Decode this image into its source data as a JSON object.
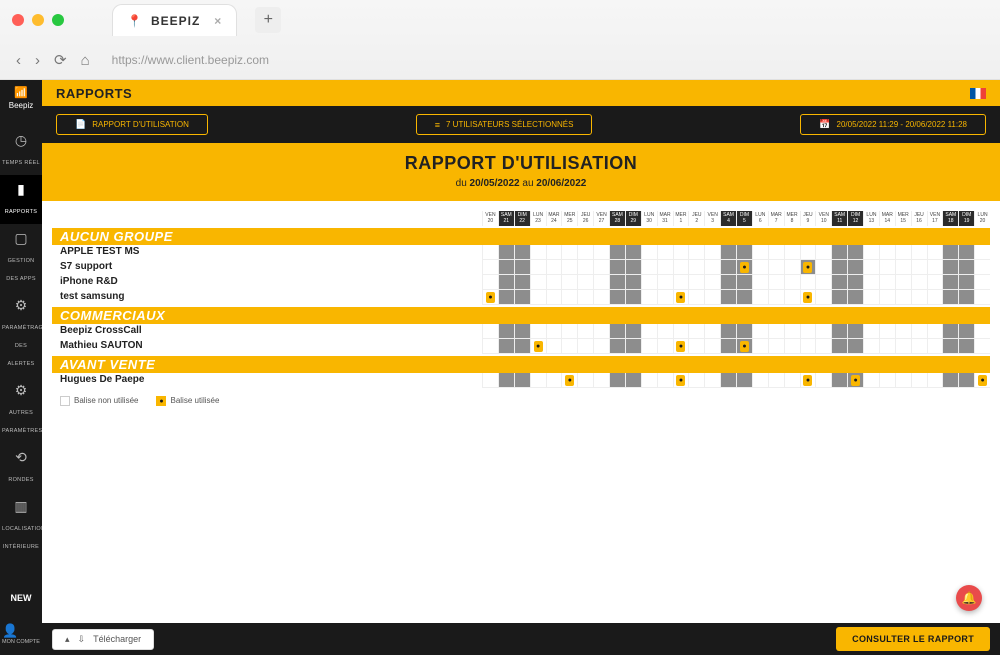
{
  "browser": {
    "tab_title": "BEEPIZ",
    "url": "https://www.client.beepiz.com"
  },
  "sidebar": {
    "brand": "Beepiz",
    "items": [
      {
        "icon": "◷",
        "label": "TEMPS RÉEL"
      },
      {
        "icon": "▮",
        "label": "RAPPORTS"
      },
      {
        "icon": "▢",
        "label": "GESTION DES APPS"
      },
      {
        "icon": "⚙",
        "label": "PARAMÉTRAGE DES ALERTES"
      },
      {
        "icon": "⚙",
        "label": "AUTRES PARAMÈTRES"
      },
      {
        "icon": "⟲",
        "label": "RONDES"
      },
      {
        "icon": "▥",
        "label": "LOCALISATION INTÉRIEURE"
      }
    ],
    "new_label": "NEW",
    "account_label": "MON COMPTE"
  },
  "header": {
    "title": "RAPPORTS"
  },
  "actions": {
    "report_type": "RAPPORT D'UTILISATION",
    "users_selected": "7 UTILISATEURS SÉLECTIONNÉS",
    "daterange": "20/05/2022 11:29 - 20/06/2022 11:28"
  },
  "subheader": {
    "title": "RAPPORT D'UTILISATION",
    "prefix": "du",
    "from": "20/05/2022",
    "middle": "au",
    "to": "20/06/2022"
  },
  "days": [
    {
      "dow": "VEN",
      "num": "20",
      "we": false
    },
    {
      "dow": "SAM",
      "num": "21",
      "we": true
    },
    {
      "dow": "DIM",
      "num": "22",
      "we": true
    },
    {
      "dow": "LUN",
      "num": "23",
      "we": false
    },
    {
      "dow": "MAR",
      "num": "24",
      "we": false
    },
    {
      "dow": "MER",
      "num": "25",
      "we": false
    },
    {
      "dow": "JEU",
      "num": "26",
      "we": false
    },
    {
      "dow": "VEN",
      "num": "27",
      "we": false
    },
    {
      "dow": "SAM",
      "num": "28",
      "we": true
    },
    {
      "dow": "DIM",
      "num": "29",
      "we": true
    },
    {
      "dow": "LUN",
      "num": "30",
      "we": false
    },
    {
      "dow": "MAR",
      "num": "31",
      "we": false
    },
    {
      "dow": "MER",
      "num": "1",
      "we": false
    },
    {
      "dow": "JEU",
      "num": "2",
      "we": false
    },
    {
      "dow": "VEN",
      "num": "3",
      "we": false
    },
    {
      "dow": "SAM",
      "num": "4",
      "we": true
    },
    {
      "dow": "DIM",
      "num": "5",
      "we": true
    },
    {
      "dow": "LUN",
      "num": "6",
      "we": false
    },
    {
      "dow": "MAR",
      "num": "7",
      "we": false
    },
    {
      "dow": "MER",
      "num": "8",
      "we": false
    },
    {
      "dow": "JEU",
      "num": "9",
      "we": false
    },
    {
      "dow": "VEN",
      "num": "10",
      "we": false
    },
    {
      "dow": "SAM",
      "num": "11",
      "we": true
    },
    {
      "dow": "DIM",
      "num": "12",
      "we": true
    },
    {
      "dow": "LUN",
      "num": "13",
      "we": false
    },
    {
      "dow": "MAR",
      "num": "14",
      "we": false
    },
    {
      "dow": "MER",
      "num": "15",
      "we": false
    },
    {
      "dow": "JEU",
      "num": "16",
      "we": false
    },
    {
      "dow": "VEN",
      "num": "17",
      "we": false
    },
    {
      "dow": "SAM",
      "num": "18",
      "we": true
    },
    {
      "dow": "DIM",
      "num": "19",
      "we": true
    },
    {
      "dow": "LUN",
      "num": "20",
      "we": false
    }
  ],
  "groups": [
    {
      "name": "AUCUN GROUPE",
      "rows": [
        {
          "name": "APPLE TEST MS",
          "cells": [
            0,
            2,
            2,
            0,
            0,
            0,
            0,
            0,
            2,
            2,
            0,
            0,
            0,
            0,
            0,
            2,
            2,
            0,
            0,
            0,
            0,
            0,
            2,
            2,
            0,
            0,
            0,
            0,
            0,
            2,
            2,
            0
          ]
        },
        {
          "name": "S7 support",
          "cells": [
            0,
            2,
            2,
            0,
            0,
            0,
            0,
            0,
            2,
            2,
            0,
            0,
            0,
            0,
            0,
            2,
            3,
            0,
            0,
            0,
            3,
            0,
            2,
            2,
            0,
            0,
            0,
            0,
            0,
            2,
            2,
            0
          ]
        },
        {
          "name": "iPhone R&D",
          "cells": [
            0,
            2,
            2,
            0,
            0,
            0,
            0,
            0,
            2,
            2,
            0,
            0,
            0,
            0,
            0,
            2,
            2,
            0,
            0,
            0,
            0,
            0,
            2,
            2,
            0,
            0,
            0,
            0,
            0,
            2,
            2,
            0
          ]
        },
        {
          "name": "test samsung",
          "cells": [
            1,
            2,
            2,
            0,
            0,
            0,
            0,
            0,
            2,
            2,
            0,
            0,
            1,
            0,
            0,
            2,
            2,
            0,
            0,
            0,
            1,
            0,
            2,
            2,
            0,
            0,
            0,
            0,
            0,
            2,
            2,
            0
          ]
        }
      ]
    },
    {
      "name": "COMMERCIAUX",
      "rows": [
        {
          "name": "Beepiz CrossCall",
          "cells": [
            0,
            2,
            2,
            0,
            0,
            0,
            0,
            0,
            2,
            2,
            0,
            0,
            0,
            0,
            0,
            2,
            2,
            0,
            0,
            0,
            0,
            0,
            2,
            2,
            0,
            0,
            0,
            0,
            0,
            2,
            2,
            0
          ]
        },
        {
          "name": "Mathieu SAUTON",
          "cells": [
            0,
            2,
            2,
            1,
            0,
            0,
            0,
            0,
            2,
            2,
            0,
            0,
            1,
            0,
            0,
            2,
            3,
            0,
            0,
            0,
            0,
            0,
            2,
            2,
            0,
            0,
            0,
            0,
            0,
            2,
            2,
            0
          ]
        }
      ]
    },
    {
      "name": "AVANT VENTE",
      "rows": [
        {
          "name": "Hugues De Paepe",
          "cells": [
            0,
            2,
            2,
            0,
            0,
            1,
            0,
            0,
            2,
            2,
            0,
            0,
            1,
            0,
            0,
            2,
            2,
            0,
            0,
            0,
            1,
            0,
            2,
            3,
            0,
            0,
            0,
            0,
            0,
            2,
            2,
            1
          ]
        }
      ]
    }
  ],
  "legend": {
    "unused": "Balise non utilisée",
    "used": "Balise utilisée"
  },
  "footer": {
    "download": "Télécharger",
    "consult": "CONSULTER LE RAPPORT"
  }
}
